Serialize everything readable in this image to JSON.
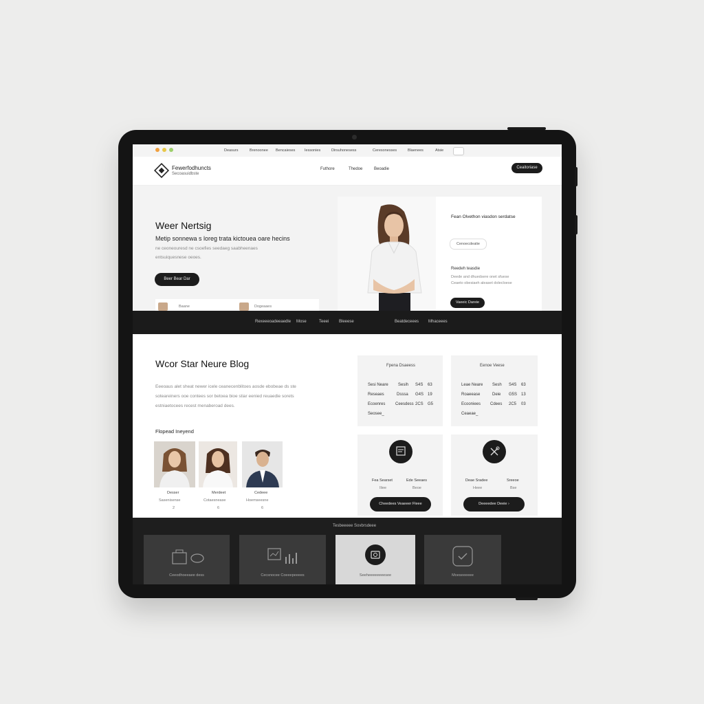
{
  "browser": {
    "tabs": [
      "Deasurs",
      "Brenoonee",
      "Bencaieses",
      "Iessonies",
      "Dirsuhonesess",
      "Ceresonesses",
      "Blaenees",
      "Atsie"
    ]
  },
  "nav": {
    "brand_title": "Fewerfodhuncts",
    "brand_subtitle": "Secoasuidbste",
    "links": [
      "Futhore",
      "Thedoe",
      "Beoadie"
    ],
    "cta": "Ceaitoriase"
  },
  "hero": {
    "title": "Weer Nertsig",
    "subtitle": "Metip sonnewa s loreg trata kictouea oare hecins",
    "body_line1": "ne ceoneouresd ne csoefies seedaeg saabheenaes",
    "body_line2": "entsuiquesnese oeoes.",
    "button": "Beer Bear Dar",
    "strip_items": [
      "Baane",
      "Dogeaaes"
    ],
    "panel_heading": "Fean Olvethon viasdon serdatse",
    "panel_input": "Cenoecdeatie",
    "panel_subheading": "Reedeh teasdie",
    "panel_text_line1": "Deede and dhuedsere onet sfuese",
    "panel_text_line2": "Ceaeto obesiaeh aleaset dolecloese",
    "panel_button": "Vaeeic Dareie"
  },
  "band": {
    "items": [
      "Rexeeeoadeeaedle",
      "Mose",
      "Teeei",
      "Bleeese",
      "Beatdeceees",
      "Mhaceees"
    ]
  },
  "blog": {
    "title": "Wcor Star Neure Blog",
    "line1": "Eeeoaus alet sheat newer icele ceanecenblitoes aosde ebobeae ds ste",
    "line2": "soteareiners ooe contees sor betoea bioe stiar eenied reuaedie sorets",
    "line3": "estniaetocees recest menaberoad dees.",
    "team_heading": "Flopead Ineyend",
    "team": [
      {
        "name": "Desser",
        "role": "Sasenisense",
        "num": "2"
      },
      {
        "name": "Merdeet",
        "role": "Cotaesnease",
        "num": "6"
      },
      {
        "name": "Cedeee",
        "role": "Hoemseesne",
        "num": "6"
      }
    ]
  },
  "stats_cards": [
    {
      "title": "Fpena Dsaeess",
      "rows": [
        [
          "Sesi Neare",
          "Sesih",
          "S4S",
          "63"
        ],
        [
          "Reseaes",
          "Dsssa",
          "G4S",
          "19"
        ],
        [
          "Ecoenres",
          "Ceesdess",
          "2CS",
          "G5"
        ],
        [
          "Seosee_",
          "",
          "",
          ""
        ]
      ]
    },
    {
      "title": "Eenoe Veese",
      "rows": [
        [
          "Leae Neare",
          "Sesh",
          "S4S",
          "63"
        ],
        [
          "Roaeease",
          "Deie",
          "G5S",
          "13"
        ],
        [
          "Ecooniees",
          "Cdees",
          "2C5",
          "03"
        ],
        [
          "Ceaeae_",
          "",
          "",
          ""
        ]
      ]
    }
  ],
  "action_cards": [
    {
      "icon": "document-icon",
      "labels": [
        "Fea Searset",
        "Ede Seeaes"
      ],
      "sub": [
        "Iliee",
        "Beoe"
      ],
      "button": "Cheedees Veaeeer Fleee"
    },
    {
      "icon": "tools-icon",
      "labels": [
        "Deae Sradee",
        "Sreeoe"
      ],
      "sub": [
        "Heee",
        "Bse"
      ],
      "button": "Deeeedee Deeie ›"
    }
  ],
  "footer": {
    "title": "Tesbeeeee Sovbrsdeee",
    "tiles": [
      {
        "icon": "bag-icon",
        "caption": "Ceeodhoeeaee dess"
      },
      {
        "icon": "chart-icon",
        "caption": "Cecsnocee Coeeepeeees"
      },
      {
        "icon": "camera-icon",
        "caption": "Seeheeeeeeeesee"
      },
      {
        "icon": "check-icon",
        "caption": "Moeseeeeee"
      }
    ]
  },
  "colors": {
    "dark": "#1c1c1c",
    "light_gray": "#f3f3f3",
    "dot_orange": "#f0a040",
    "dot_yellow": "#e8c84a",
    "dot_green": "#9ccf6a"
  }
}
